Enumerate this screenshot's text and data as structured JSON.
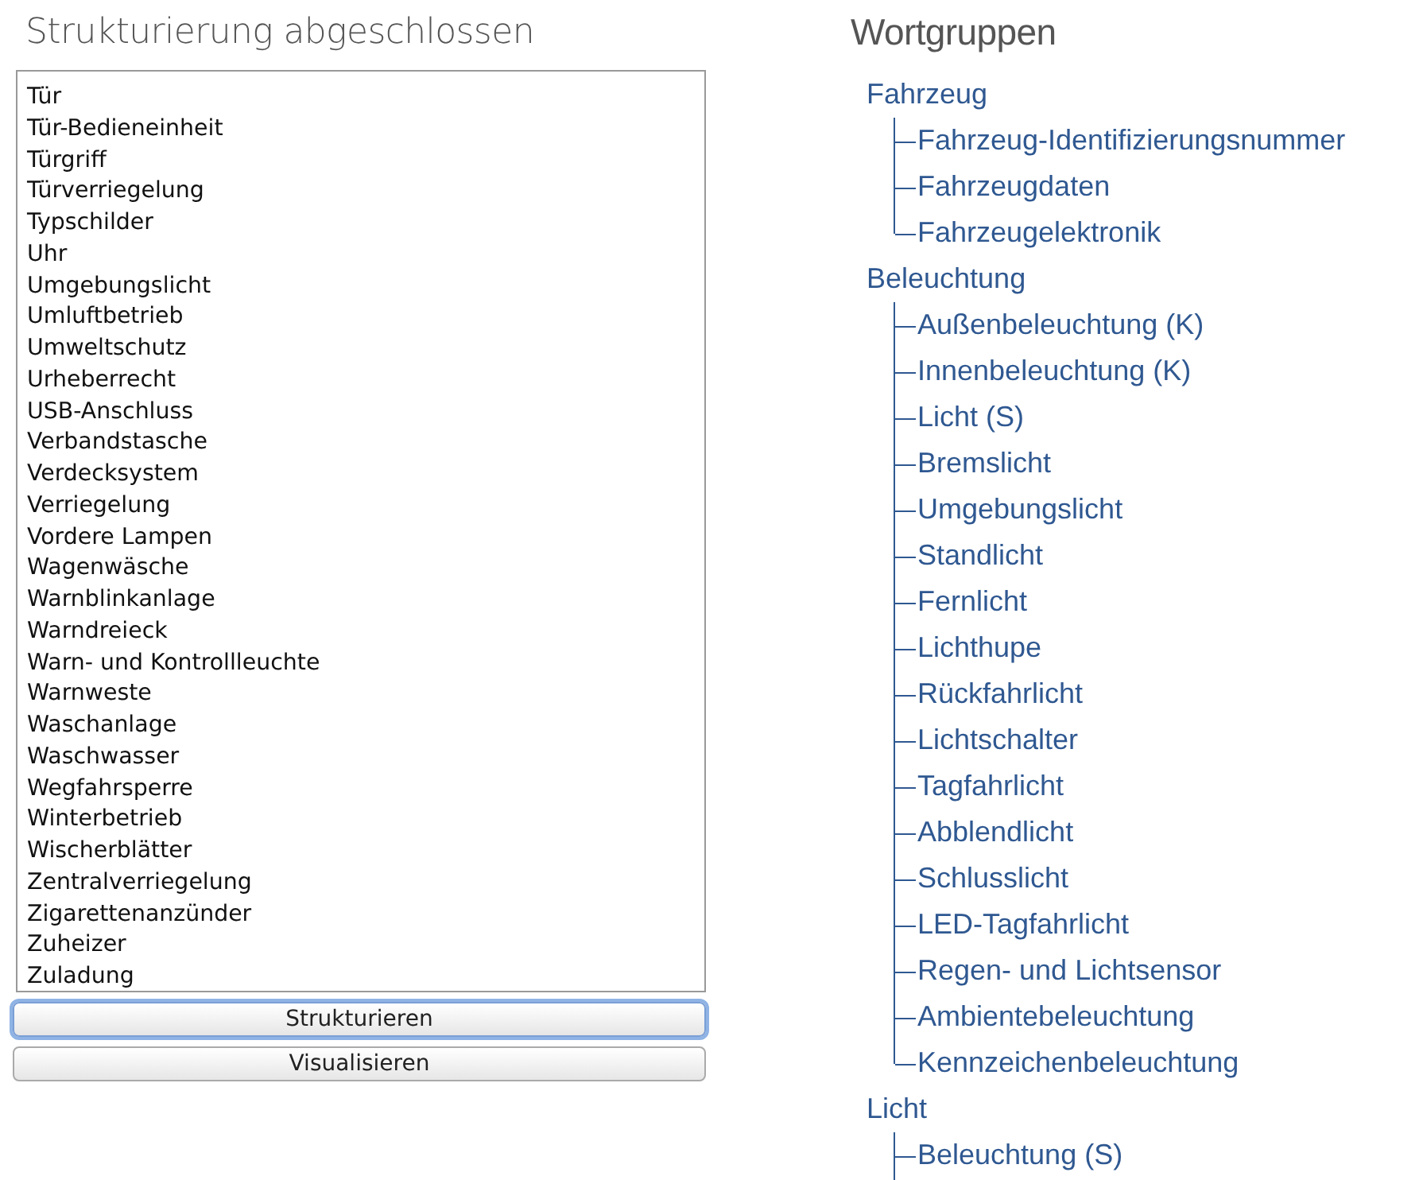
{
  "left": {
    "title": "Strukturierung abgeschlossen",
    "text_area": {
      "lines": [
        "Tür",
        "Tür-Bedieneinheit",
        "Türgriff",
        "Türverriegelung",
        "Typschilder",
        "Uhr",
        "Umgebungslicht",
        "Umluftbetrieb",
        "Umweltschutz",
        "Urheberrecht",
        "USB-Anschluss",
        "Verbandstasche",
        "Verdecksystem",
        "Verriegelung",
        "Vordere Lampen",
        "Wagenwäsche",
        "Warnblinkanlage",
        "Warndreieck",
        "Warn- und Kontrollleuchte",
        "Warnweste",
        "Waschanlage",
        "Waschwasser",
        "Wegfahrsperre",
        "Winterbetrieb",
        "Wischerblätter",
        "Zentralverriegelung",
        "Zigarettenanzünder",
        "Zuheizer",
        "Zuladung"
      ]
    },
    "buttons": [
      {
        "label": "Strukturieren",
        "focused": true
      },
      {
        "label": "Visualisieren",
        "focused": false
      }
    ]
  },
  "right": {
    "title": "Wortgruppen",
    "tree": [
      {
        "label": "Fahrzeug",
        "children": [
          {
            "label": "Fahrzeug-Identifizierungsnummer"
          },
          {
            "label": "Fahrzeugdaten"
          },
          {
            "label": "Fahrzeugelektronik"
          }
        ]
      },
      {
        "label": "Beleuchtung",
        "children": [
          {
            "label": "Außenbeleuchtung (K)"
          },
          {
            "label": "Innenbeleuchtung (K)"
          },
          {
            "label": "Licht (S)"
          },
          {
            "label": "Bremslicht"
          },
          {
            "label": "Umgebungslicht"
          },
          {
            "label": "Standlicht"
          },
          {
            "label": "Fernlicht"
          },
          {
            "label": "Lichthupe"
          },
          {
            "label": "Rückfahrlicht"
          },
          {
            "label": "Lichtschalter"
          },
          {
            "label": "Tagfahrlicht"
          },
          {
            "label": "Abblendlicht"
          },
          {
            "label": "Schlusslicht"
          },
          {
            "label": "LED-Tagfahrlicht"
          },
          {
            "label": "Regen- und Lichtsensor"
          },
          {
            "label": "Ambientebeleuchtung"
          },
          {
            "label": "Kennzeichenbeleuchtung"
          }
        ]
      },
      {
        "label": "Licht",
        "children": [
          {
            "label": "Beleuchtung (S)"
          }
        ],
        "continues": true
      }
    ]
  }
}
